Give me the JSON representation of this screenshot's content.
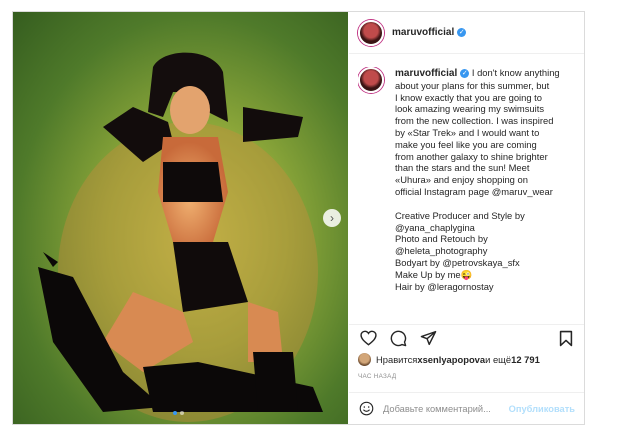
{
  "post": {
    "username": "maruvofficial",
    "caption_lines": [
      " I don't know anything",
      "about your plans for this summer, but",
      "I know exactly that you are going to",
      "look amazing wearing my swimsuits",
      "from the new collection. I was inspired",
      "by «Star Trek» and I would want to",
      "make you feel like you are coming",
      "from another galaxy to shine brighter",
      "than the stars and the sun! Meet",
      "«Uhura» and enjoy shopping on",
      "official Instagram page @maruv_wear"
    ],
    "credits": [
      "Creative Producer and Style by",
      "@yana_chaplygina",
      "Photo and Retouch by",
      "@heleta_photography",
      "Bodyart by @petrovskaya_sfx",
      "Make Up by me😜",
      "Hair by @leragornostay"
    ],
    "likes": {
      "prefix": "Нравится ",
      "user": "xsenlyapopova",
      "middle": " и ещё ",
      "count": "12 791"
    },
    "time_ago": "ЧАС НАЗАД",
    "comment": {
      "placeholder": "Добавьте комментарий...",
      "publish_label": "Опубликовать"
    }
  },
  "icons": {
    "verified": "verified-badge-icon",
    "like": "heart-icon",
    "comment": "comment-bubble-icon",
    "share": "paper-plane-icon",
    "save": "bookmark-icon",
    "emoji": "smiley-icon",
    "next": "chevron-right-icon"
  },
  "carousel": {
    "current": 1,
    "total": 2
  },
  "colors": {
    "accent": "#3897f0",
    "link": "#00376b",
    "muted": "#8e8e8e",
    "publish_disabled": "#b2dffc"
  }
}
